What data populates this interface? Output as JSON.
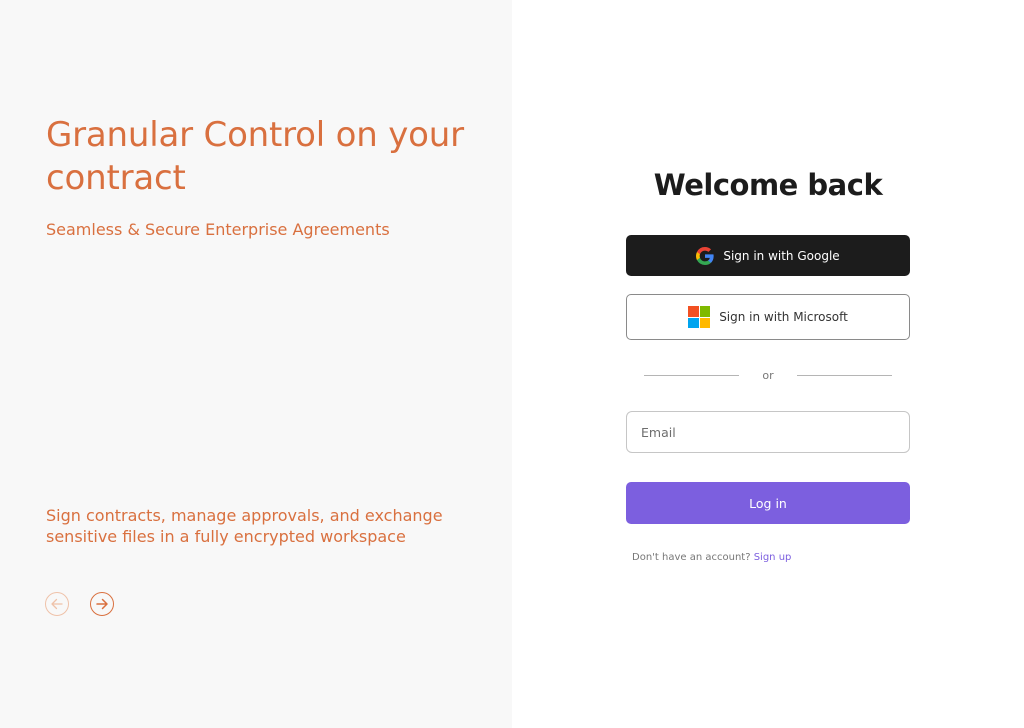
{
  "hero": {
    "title": "Granular Control on your contract",
    "subtitle": "Seamless & Secure Enterprise Agreements",
    "body": "Sign contracts, manage approvals, and exchange sensitive files in a fully encrypted workspace",
    "prev_icon": "arrow-left-circle-icon",
    "next_icon": "arrow-right-circle-icon"
  },
  "auth": {
    "heading": "Welcome back",
    "google_label": "Sign in with Google",
    "microsoft_label": "Sign in with Microsoft",
    "divider_text": "or",
    "email_placeholder": "Email",
    "email_value": "",
    "login_label": "Log in",
    "no_account_text": "Don't have an account?",
    "signup_label": "Sign up"
  },
  "colors": {
    "accent_orange": "#d9703f",
    "accent_purple": "#7c5fdf",
    "dark_button": "#1c1c1c"
  }
}
